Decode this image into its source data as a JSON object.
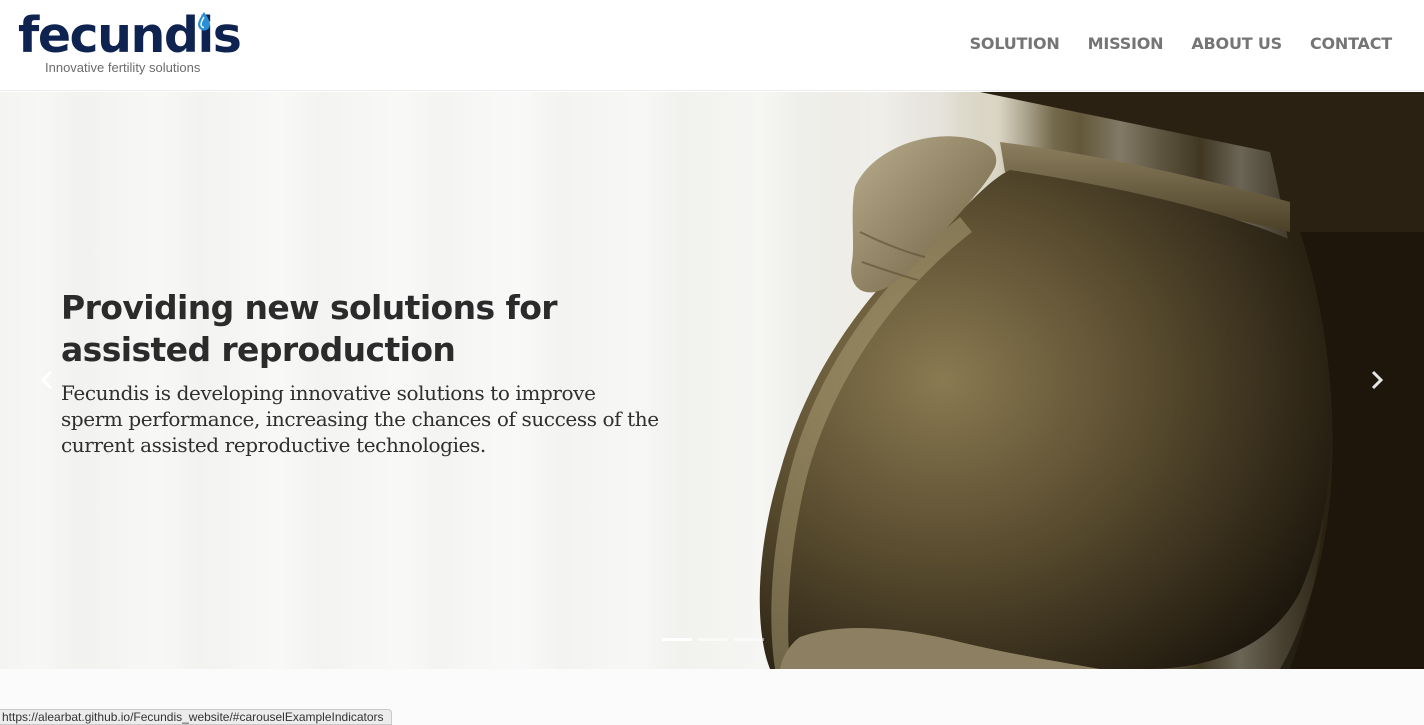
{
  "brand": {
    "name": "fecundis",
    "tagline": "Innovative fertility solutions",
    "color": "#0f2350",
    "accent": "#2a8fd6"
  },
  "nav": {
    "items": [
      {
        "label": "SOLUTION"
      },
      {
        "label": "MISSION"
      },
      {
        "label": "ABOUT US"
      },
      {
        "label": "CONTACT"
      }
    ]
  },
  "hero": {
    "title": "Providing new solutions for assisted reproduction",
    "text": "Fecundis is developing innovative solutions to improve sperm performance, increasing the chances of success of the current assisted reproductive technologies.",
    "prev_icon": "chevron-left-icon",
    "next_icon": "chevron-right-icon",
    "slide_count": 3,
    "active_slide": 1
  },
  "status_bar": {
    "url": "https://alearbat.github.io/Fecundis_website/#carouselExampleIndicators"
  }
}
